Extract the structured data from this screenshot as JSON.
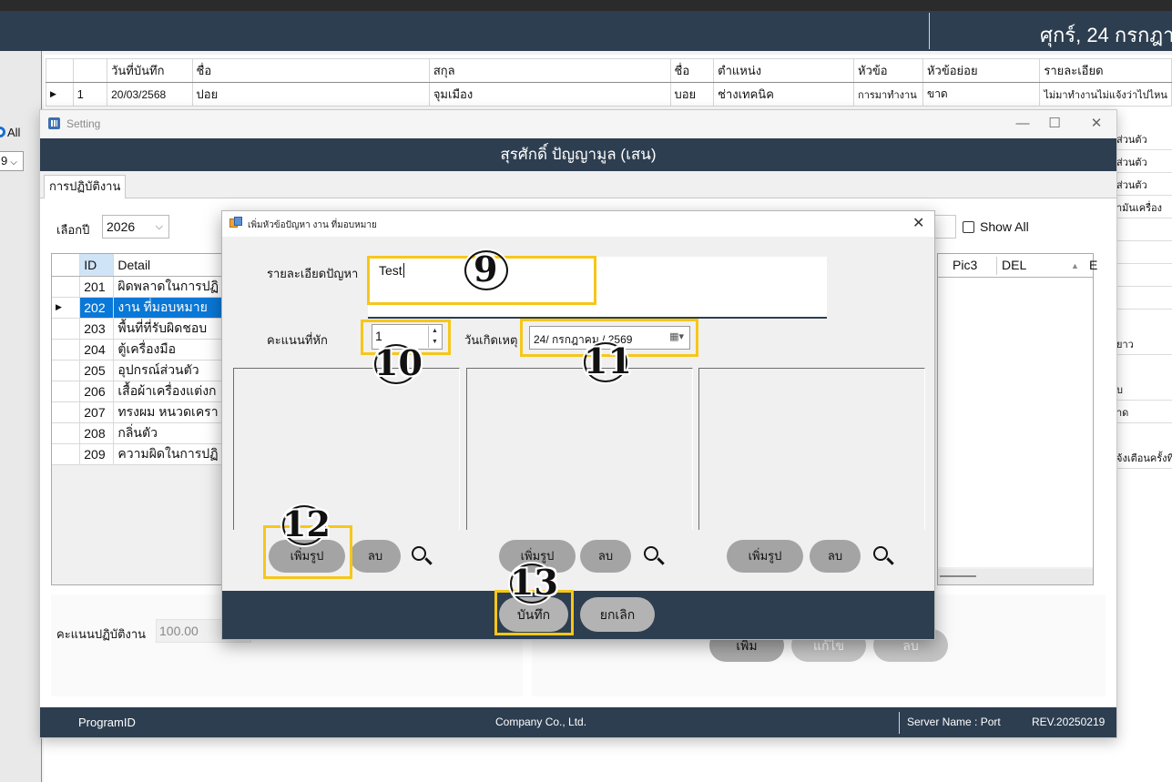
{
  "main": {
    "date": "ศุกร์, 24 กรกฎา",
    "all_label": "All",
    "left_select": "9",
    "grid_headers": [
      "",
      "วันที่บันทึก",
      "ชื่อ",
      "สกุล",
      "ชื่อ",
      "ตำแหน่ง",
      "หัวข้อ",
      "หัวข้อย่อย",
      "รายละเอียด"
    ],
    "grid_row": {
      "row": "1",
      "date": "20/03/2568",
      "first": "ปอย",
      "last": "จุมเมือง",
      "nick": "บอย",
      "position": "ช่างเทคนิค",
      "topic": "การมาทำงาน",
      "subtopic": "ขาด",
      "detail": "ไม่มาทำงานไม่แจ้งว่าไปไหน"
    },
    "right_col": [
      "ส่วนตัว",
      "ส่วนตัว",
      "ส่วนตัว",
      "ามันเครื่อง",
      "",
      "",
      "",
      "",
      "ยาว",
      "",
      "บ",
      "าด",
      "",
      "จ้งเตือนครั้งที่",
      ""
    ]
  },
  "setting": {
    "window_title": "Setting",
    "header": "สุรศักดิ์ ปัญญามูล (เสน)",
    "tab": "การปฏิบัติงาน",
    "year_label": "เลือกปี",
    "year_value": "2026",
    "grid_id_header": "ID",
    "grid_detail_header": "Detail",
    "rows": [
      {
        "id": "201",
        "detail": "ผิดพลาดในการปฏิ"
      },
      {
        "id": "202",
        "detail": "งาน ที่มอบหมาย"
      },
      {
        "id": "203",
        "detail": "พื้นที่ที่รับผิดชอบ"
      },
      {
        "id": "204",
        "detail": "ตู้เครื่องมือ"
      },
      {
        "id": "205",
        "detail": "อุปกรณ์ส่วนตัว"
      },
      {
        "id": "206",
        "detail": "เสื้อผ้าเครื่องแต่งก"
      },
      {
        "id": "207",
        "detail": "ทรงผม หนวดเครา"
      },
      {
        "id": "208",
        "detail": "กลิ่นตัว"
      },
      {
        "id": "209",
        "detail": "ความผิดในการปฏิ"
      }
    ],
    "show_all_label": "Show All",
    "right_grid_headers": {
      "pic3": "Pic3",
      "del": "DEL",
      "e": "E"
    },
    "score_label": "คะแนนปฏิบัติงาน",
    "score_value": "100.00",
    "buttons": {
      "add": "เพิ่ม",
      "edit": "แก้ไข",
      "delete": "ลบ"
    },
    "footer": {
      "program_id": "ProgramID",
      "company": "Company Co., Ltd.",
      "server": "Server Name : Port",
      "rev": "REV.20250219"
    }
  },
  "dialog": {
    "title": "เพิ่มหัวข้อปัญหา งาน ที่มอบหมาย",
    "detail_label": "รายละเอียดปัญหา",
    "detail_value": "Test",
    "score_label": "คะแนนที่หัก",
    "score_value": "1",
    "date_label": "วันเกิดเหตุ",
    "date_value": "24/ กรกฎาคม / 2569",
    "add_pic_label": "เพิ่มรูป",
    "delete_label": "ลบ",
    "save_label": "บันทึก",
    "cancel_label": "ยกเลิก"
  },
  "annotations": {
    "n9": "9",
    "n10": "10",
    "n11": "11",
    "n12": "12",
    "n13": "13"
  },
  "colors": {
    "header": "#2d3e50",
    "highlight": "#f6c71a",
    "selection": "#0a78d7"
  }
}
